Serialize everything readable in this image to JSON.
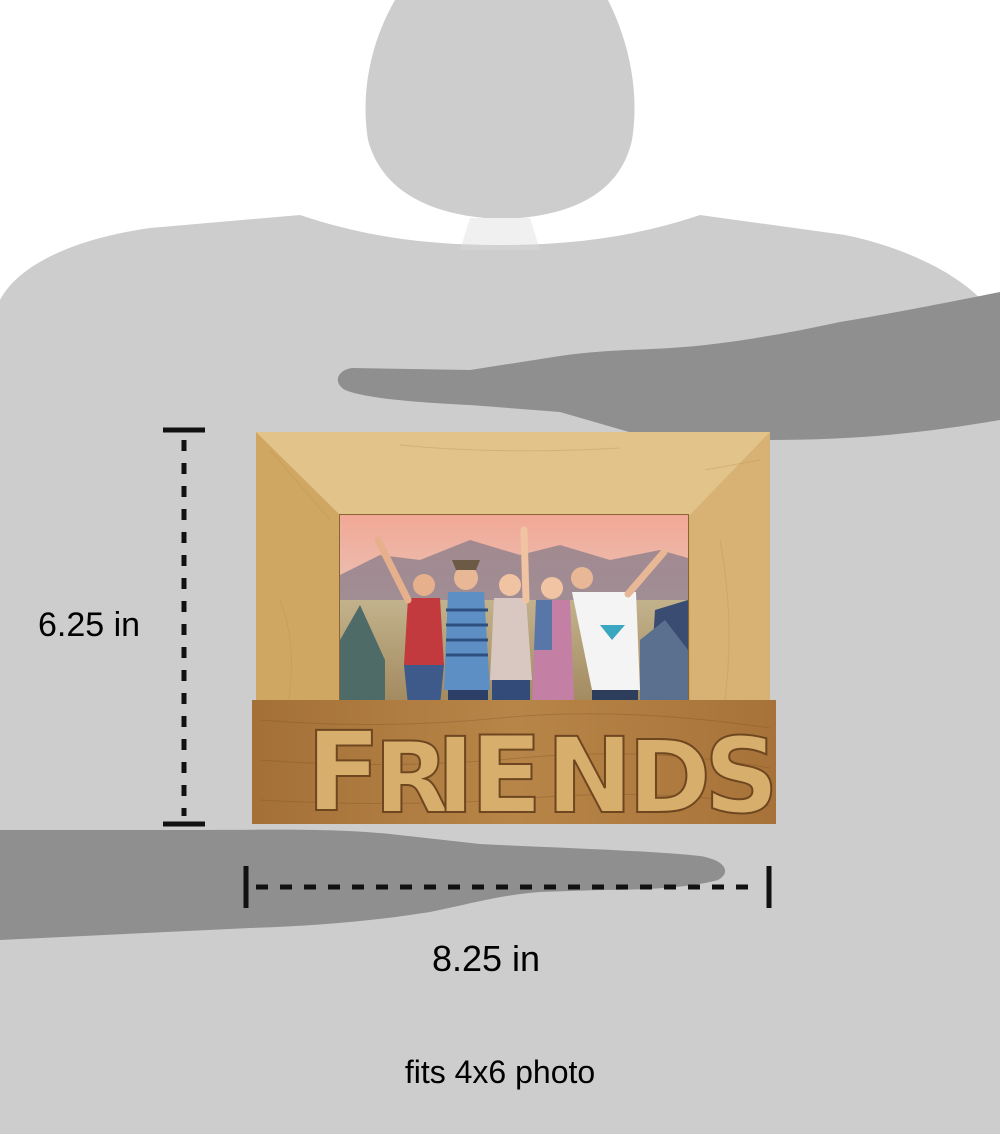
{
  "product": {
    "frame_word": "FRIENDS",
    "frame_word_display": [
      "F",
      "R",
      "I",
      "E",
      "N",
      "D",
      "S"
    ]
  },
  "dimensions": {
    "height_label": "6.25 in",
    "width_label": "8.25 in"
  },
  "caption": "fits 4x6 photo",
  "colors": {
    "silhouette": "#cdcdcd",
    "hands": "#8f8f8f",
    "wood_light": "#d9b574",
    "wood_dark": "#a8743a",
    "dimension_lines": "#111111"
  }
}
